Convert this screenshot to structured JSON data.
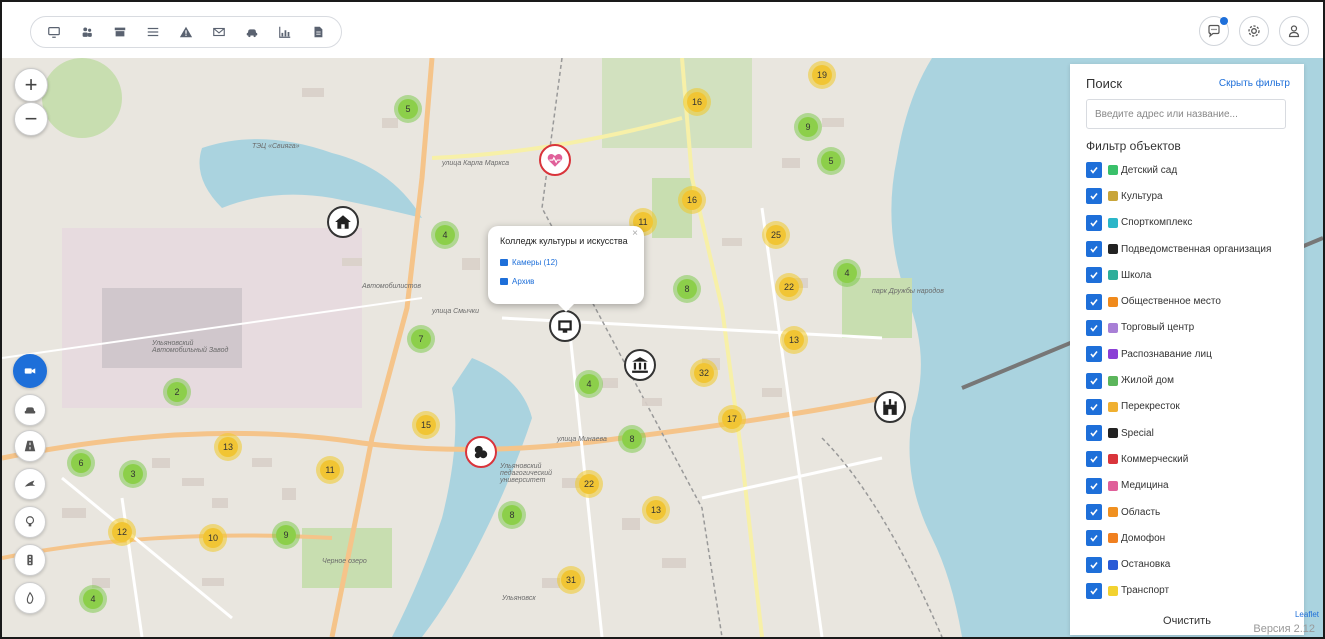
{
  "toolbar": {
    "items": [
      {
        "name": "monitor-icon"
      },
      {
        "name": "people-icon"
      },
      {
        "name": "archive-icon"
      },
      {
        "name": "list-icon"
      },
      {
        "name": "warning-icon"
      },
      {
        "name": "mail-icon"
      },
      {
        "name": "car-icon"
      },
      {
        "name": "chart-icon"
      },
      {
        "name": "document-icon"
      }
    ]
  },
  "header_right": {
    "chat_icon": "chat-icon",
    "settings_icon": "gear-icon",
    "user_icon": "user-icon"
  },
  "map": {
    "zoom_in": "+",
    "zoom_out": "−",
    "labels": {
      "factory": "Ульяновский Автомобильный Завод",
      "park": "парк Дружбы народов",
      "street_mikhaylova": "улица Минаева",
      "street_smychki": "улица Смычки",
      "ulyanovsk": "Ульяновск",
      "college": "Ульяновский педагогический университет",
      "zavolzh": "Черное озеро",
      "chp": "ТЭЦ «Свияга»",
      "karl_marx": "улица Карла Маркса",
      "avtozavod": "Автомобилистов"
    },
    "clusters_yellow": [
      "19",
      "16",
      "16",
      "11",
      "25",
      "22",
      "13",
      "32",
      "17",
      "15",
      "13",
      "11",
      "22",
      "13",
      "12",
      "10",
      "31"
    ],
    "clusters_green": [
      "5",
      "9",
      "5",
      "4",
      "4",
      "8",
      "7",
      "4",
      "2",
      "8",
      "6",
      "3",
      "9",
      "8",
      "4"
    ]
  },
  "popup": {
    "title": "Колледж культуры и искусства",
    "close": "×",
    "cameras_link": "Камеры (12)",
    "archive_link": "Архив"
  },
  "sidebar": {
    "search_title": "Поиск",
    "hide_filter": "Скрыть фильтр",
    "search_placeholder": "Введите адрес или название...",
    "filter_title": "Фильтр объектов",
    "items": [
      {
        "label": "Детский сад",
        "color": "#39c06a"
      },
      {
        "label": "Культура",
        "color": "#c8a53a"
      },
      {
        "label": "Спорткомплекс",
        "color": "#2bb6c8"
      },
      {
        "label": "Подведомственная организация",
        "color": "#222222"
      },
      {
        "label": "Школа",
        "color": "#2eae9a"
      },
      {
        "label": "Общественное место",
        "color": "#f08a1c"
      },
      {
        "label": "Торговый центр",
        "color": "#a87fd6"
      },
      {
        "label": "Распознавание лиц",
        "color": "#8b3fd6"
      },
      {
        "label": "Жилой дом",
        "color": "#5bb55b"
      },
      {
        "label": "Перекресток",
        "color": "#f0b030"
      },
      {
        "label": "Special",
        "color": "#222222"
      },
      {
        "label": "Коммерческий",
        "color": "#d9343b"
      },
      {
        "label": "Медицина",
        "color": "#e0609a"
      },
      {
        "label": "Область",
        "color": "#f09020"
      },
      {
        "label": "Домофон",
        "color": "#f08020"
      },
      {
        "label": "Остановка",
        "color": "#2a5bd6"
      },
      {
        "label": "Транспорт",
        "color": "#f2d230"
      }
    ],
    "clear": "Очистить"
  },
  "footer": {
    "version": "Версия 2.12",
    "attribution": "Leaflet"
  }
}
